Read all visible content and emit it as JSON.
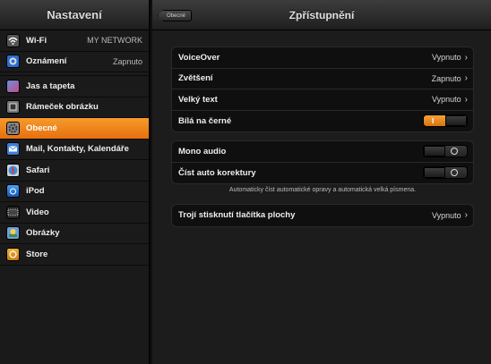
{
  "colors": {
    "accent": "#f08321",
    "sidebar_bg": "#1a1a1a",
    "main_bg": "#1c1c1c"
  },
  "sidebar": {
    "title": "Nastavení",
    "items": [
      {
        "label": "Wi-Fi",
        "value": "MY NETWORK",
        "icon": "wifi-icon"
      },
      {
        "label": "Oznámení",
        "value": "Zapnuto",
        "icon": "notifications-icon"
      },
      {
        "label": "Jas a tapeta",
        "value": "",
        "icon": "brightness-wallpaper-icon"
      },
      {
        "label": "Rámeček obrázku",
        "value": "",
        "icon": "picture-frame-icon"
      },
      {
        "label": "Obecné",
        "value": "",
        "icon": "general-gear-icon",
        "selected": true
      },
      {
        "label": "Mail, Kontakty, Kalendáře",
        "value": "",
        "icon": "mail-icon"
      },
      {
        "label": "Safari",
        "value": "",
        "icon": "safari-icon"
      },
      {
        "label": "iPod",
        "value": "",
        "icon": "ipod-icon"
      },
      {
        "label": "Video",
        "value": "",
        "icon": "video-icon"
      },
      {
        "label": "Obrázky",
        "value": "",
        "icon": "photos-icon"
      },
      {
        "label": "Store",
        "value": "",
        "icon": "store-icon"
      }
    ]
  },
  "nav": {
    "back_label": "Obecné",
    "title": "Zpřístupnění"
  },
  "groups": [
    {
      "rows": [
        {
          "label": "VoiceOver",
          "value": "Vypnuto",
          "type": "disclosure"
        },
        {
          "label": "Zvětšení",
          "value": "Zapnuto",
          "type": "disclosure"
        },
        {
          "label": "Velký text",
          "value": "Vypnuto",
          "type": "disclosure"
        },
        {
          "label": "Bílá na černé",
          "type": "toggle",
          "on": true,
          "on_text": "I"
        }
      ]
    },
    {
      "rows": [
        {
          "label": "Mono audio",
          "type": "toggle",
          "on": false
        },
        {
          "label": "Číst auto korektury",
          "type": "toggle",
          "on": false
        }
      ]
    },
    {
      "rows": [
        {
          "label": "Trojí stisknutí tlačítka plochy",
          "value": "Vypnuto",
          "type": "disclosure"
        }
      ]
    }
  ],
  "footer_note": "Automaticky číst automatické opravy a automatická velká písmena."
}
